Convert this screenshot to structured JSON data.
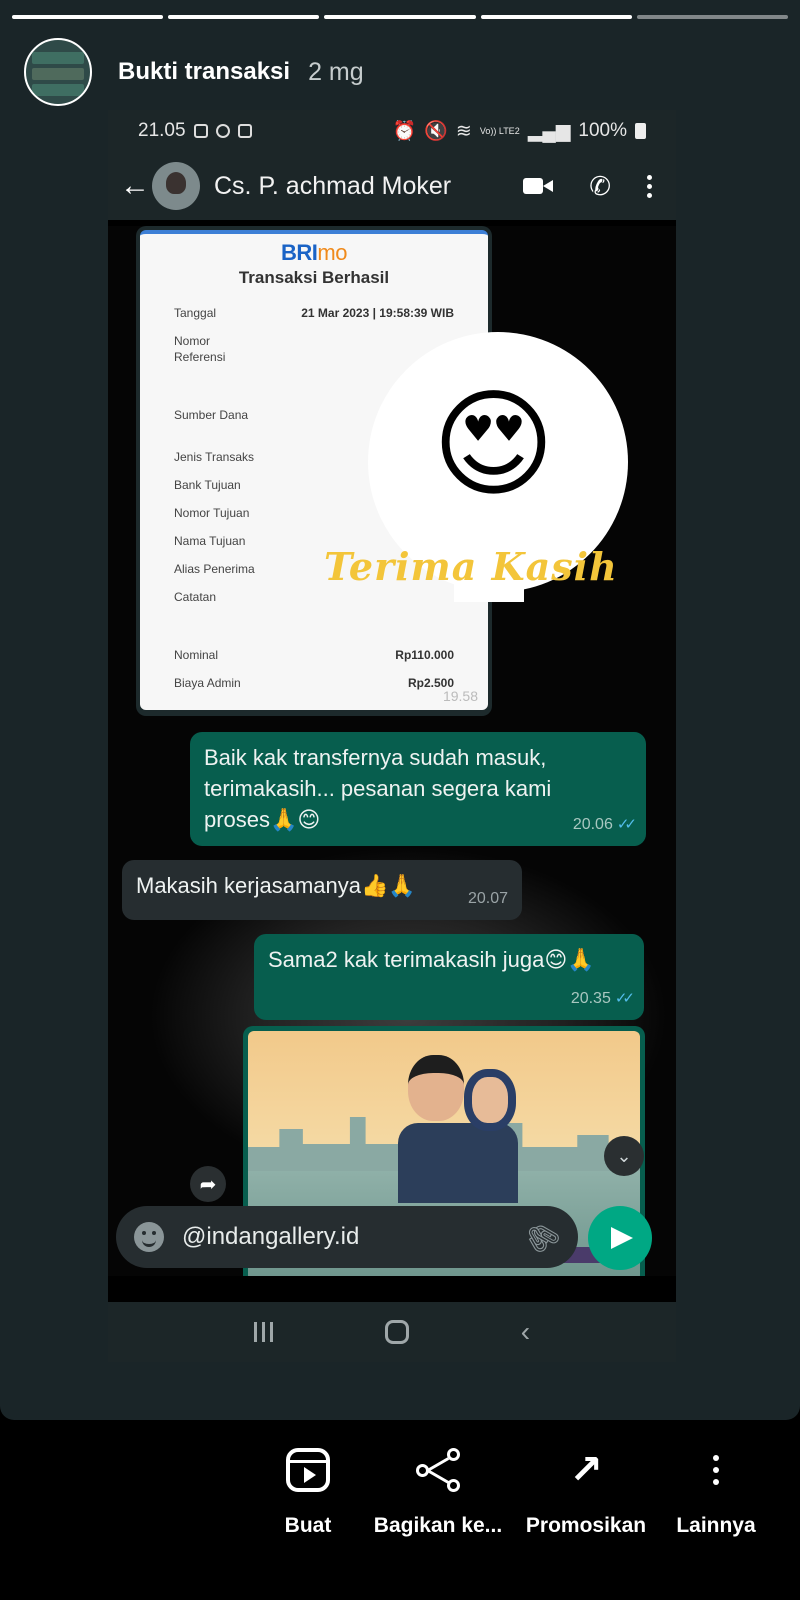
{
  "story": {
    "title": "Bukti transaksi",
    "time": "2 mg",
    "progress_segments": 5,
    "progress_done": 4
  },
  "status_bar": {
    "time": "21.05",
    "battery": "100%",
    "carrier": "Vo)) LTE2"
  },
  "chat_header": {
    "contact_name": "Cs. P. achmad Moker"
  },
  "receipt": {
    "brand": "BRI",
    "brand_suffix": "mo",
    "title": "Transaksi Berhasil",
    "rows": [
      {
        "label": "Tanggal",
        "value": "21 Mar 2023 | 19:58:39 WIB"
      },
      {
        "label": "Nomor",
        "value": ""
      },
      {
        "label": "Referensi",
        "value": ""
      },
      {
        "label": "Sumber Dana",
        "value": ""
      },
      {
        "label": "Jenis Transaks",
        "value": ""
      },
      {
        "label": "Bank Tujuan",
        "value": ""
      },
      {
        "label": "Nomor Tujuan",
        "value": ""
      },
      {
        "label": "Nama Tujuan",
        "value": ""
      },
      {
        "label": "Alias Penerima",
        "value": ""
      },
      {
        "label": "Catatan",
        "value": ""
      },
      {
        "label": "Nominal",
        "value": "Rp110.000"
      },
      {
        "label": "Biaya Admin",
        "value": "Rp2.500"
      }
    ],
    "time": "19.58"
  },
  "sticker": {
    "text": "Terima Kasih",
    "emoji": "😍"
  },
  "messages": [
    {
      "direction": "out",
      "text": "Baik kak transfernya sudah masuk, terimakasih... pesanan segera kami proses🙏😊",
      "time": "20.06"
    },
    {
      "direction": "in",
      "text": "Makasih kerjasamanya👍🙏",
      "time": "20.07"
    },
    {
      "direction": "out",
      "text": "Sama2 kak terimakasih juga😊🙏",
      "time": "20.35"
    }
  ],
  "input": {
    "value": "@indangallery.id"
  },
  "actions": [
    {
      "label": "Buat",
      "icon": "reels-icon"
    },
    {
      "label": "Bagikan ke...",
      "icon": "share-icon"
    },
    {
      "label": "Promosikan",
      "icon": "trending-up-icon"
    },
    {
      "label": "Lainnya",
      "icon": "more-vertical-icon"
    }
  ],
  "colors": {
    "card_bg": "#1a2528",
    "outgoing_bubble": "#075e4e",
    "incoming_bubble": "#262d30",
    "send_button": "#00a884",
    "sticker_text": "#f3c53a"
  }
}
